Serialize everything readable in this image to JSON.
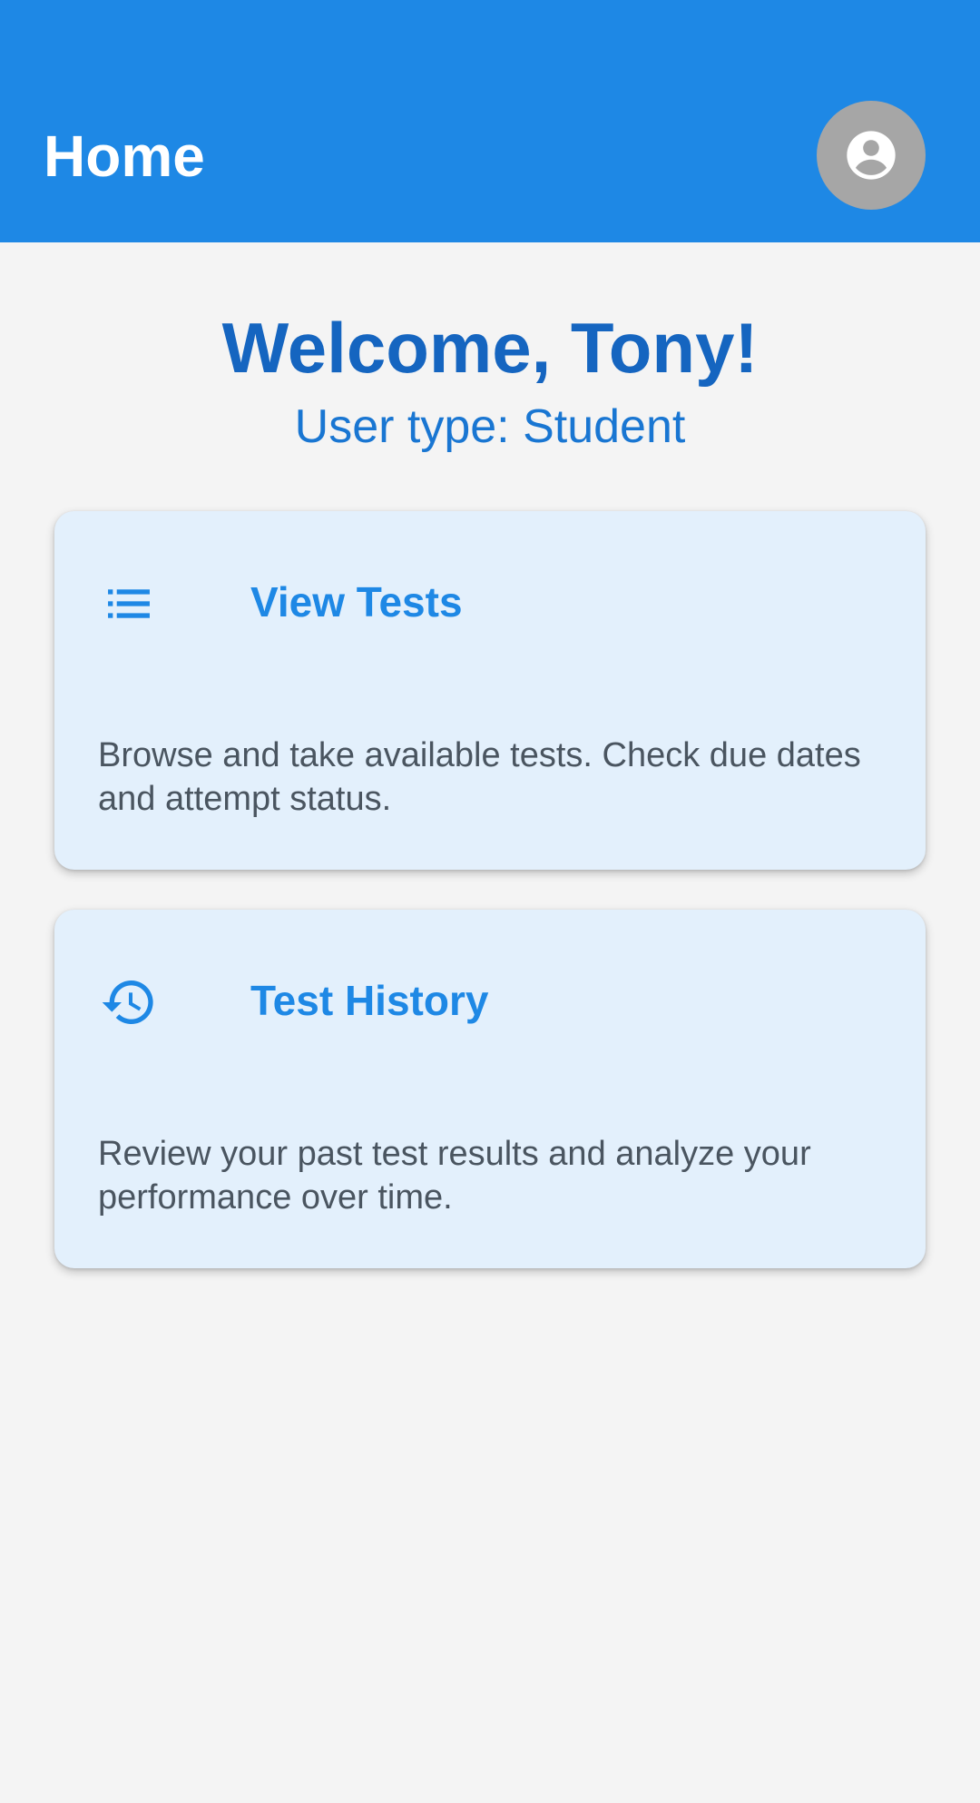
{
  "app_bar": {
    "title": "Home",
    "avatar_icon": "account-circle-icon",
    "background_color": "#1e88e5"
  },
  "welcome": {
    "heading": "Welcome, Tony!",
    "user_type": "User type: Student"
  },
  "cards": [
    {
      "icon": "list-icon",
      "title": "View Tests",
      "description": "Browse and take available tests. Check due dates and attempt status."
    },
    {
      "icon": "history-icon",
      "title": "Test History",
      "description": "Review your past test results and analyze your performance over time."
    }
  ],
  "colors": {
    "accent": "#1e88e5",
    "heading": "#1565c0",
    "card_background": "#e3f0fc",
    "page_background": "#f4f4f4"
  }
}
